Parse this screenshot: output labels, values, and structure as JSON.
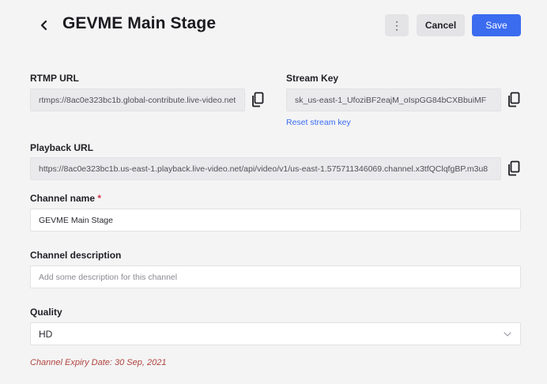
{
  "header": {
    "title": "GEVME Main Stage",
    "more_label": "⋮",
    "cancel_label": "Cancel",
    "save_label": "Save"
  },
  "rtmp": {
    "label": "RTMP URL",
    "value": "rtmps://8ac0e323bc1b.global-contribute.live-video.net"
  },
  "stream_key": {
    "label": "Stream Key",
    "value": "sk_us-east-1_UfoziBF2eajM_oIspGG84bCXBbuiMF",
    "reset_label": "Reset stream key"
  },
  "playback": {
    "label": "Playback URL",
    "value": "https://8ac0e323bc1b.us-east-1.playback.live-video.net/api/video/v1/us-east-1.575711346069.channel.x3tfQClqfgBP.m3u8"
  },
  "channel_name": {
    "label": "Channel name",
    "required_mark": "*",
    "value": "GEVME Main Stage"
  },
  "channel_description": {
    "label": "Channel description",
    "placeholder": "Add some description for this channel"
  },
  "quality": {
    "label": "Quality",
    "selected": "HD"
  },
  "expiry": {
    "text": "Channel Expiry Date: 30 Sep, 2021"
  },
  "icons": {
    "back": "chevron-left-icon",
    "more": "more-vertical-icon",
    "copy": "copy-icon",
    "dropdown": "chevron-down-icon"
  },
  "colors": {
    "primary": "#3b6cf0",
    "required": "#d6334a",
    "expiry": "#b0453f",
    "background": "#f4f4f5"
  }
}
